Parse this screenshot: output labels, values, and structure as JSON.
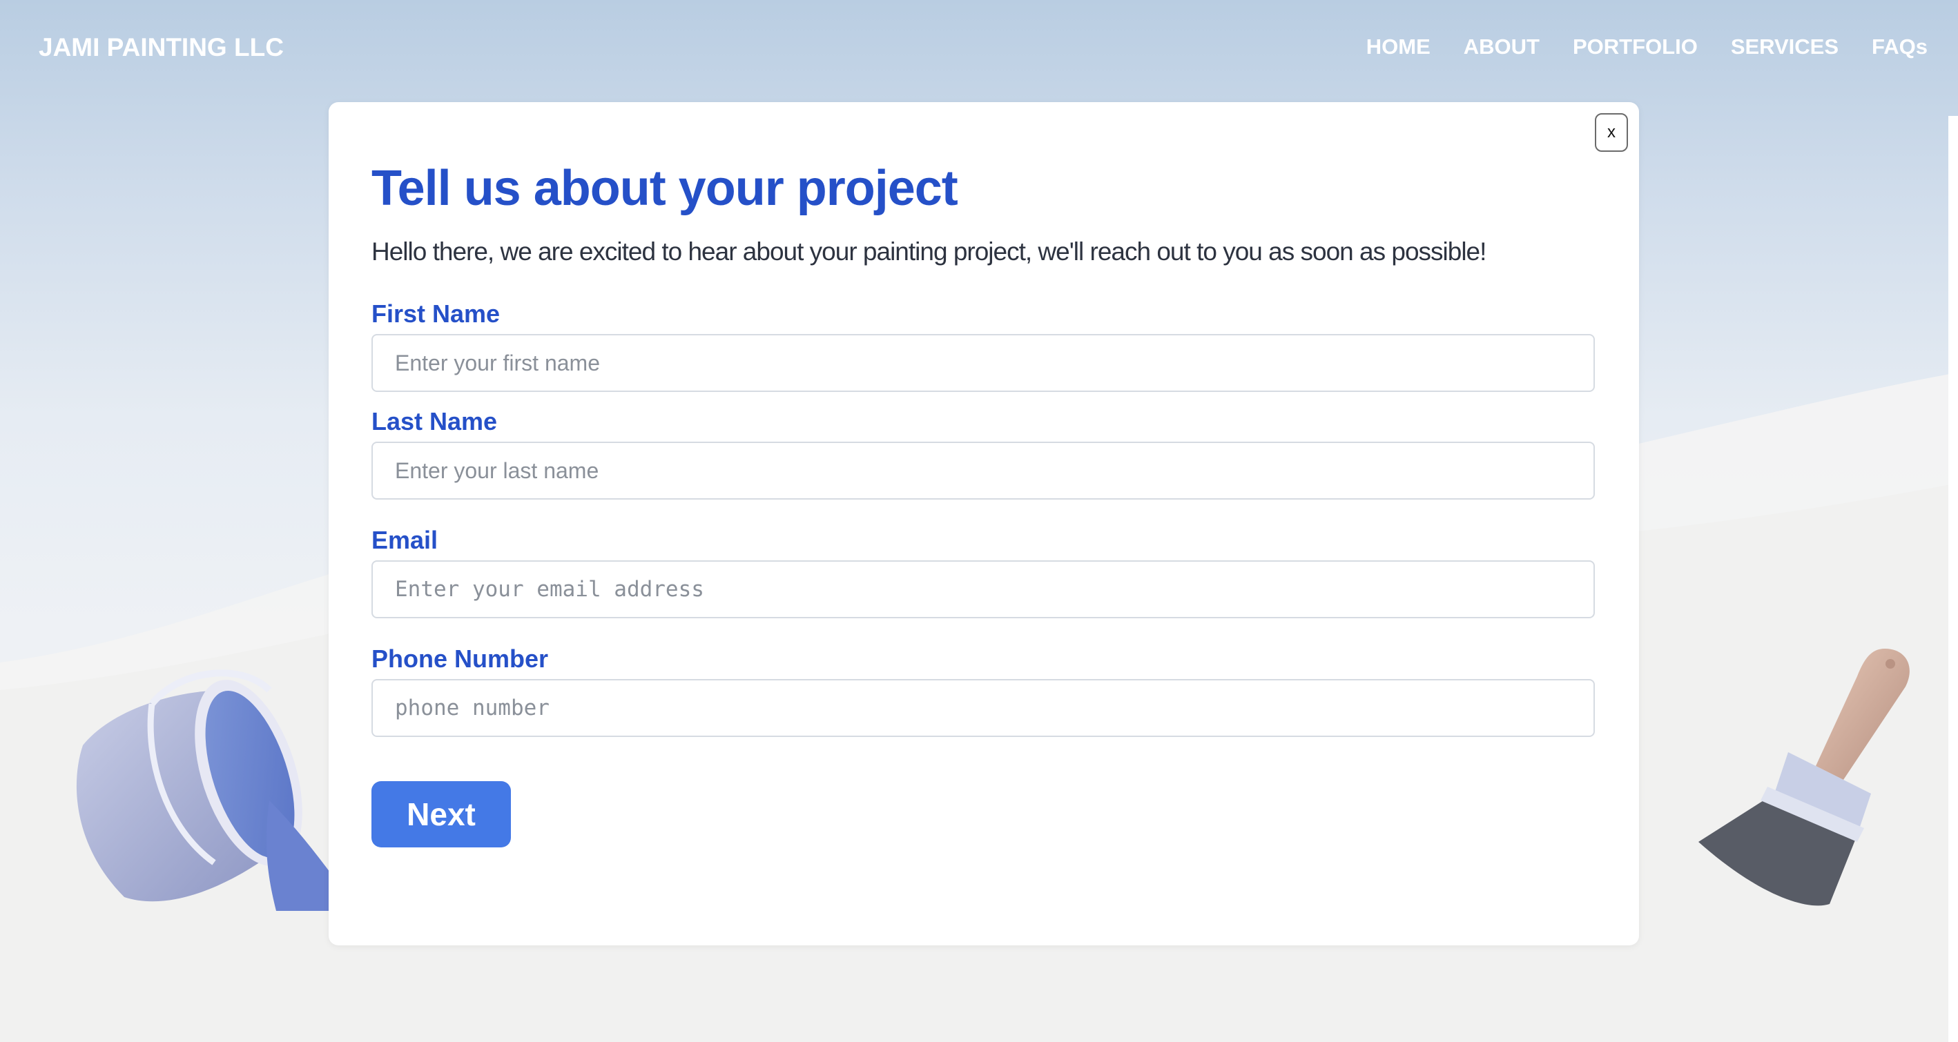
{
  "header": {
    "brand": "JAMI PAINTING LLC",
    "nav": [
      "HOME",
      "ABOUT",
      "PORTFOLIO",
      "SERVICES",
      "FAQs"
    ]
  },
  "modal": {
    "close_label": "x",
    "title": "Tell us about your project",
    "subtitle": "Hello there, we are excited to hear about your painting project, we'll reach out to you as soon as possible!",
    "fields": {
      "first_name": {
        "label": "First Name",
        "placeholder": "Enter your first name",
        "value": ""
      },
      "last_name": {
        "label": "Last Name",
        "placeholder": "Enter your last name",
        "value": ""
      },
      "email": {
        "label": "Email",
        "placeholder": "Enter your email address",
        "value": ""
      },
      "phone": {
        "label": "Phone Number",
        "placeholder": "phone number",
        "value": ""
      }
    },
    "next_label": "Next"
  },
  "colors": {
    "accent": "#2550c8",
    "button": "#4479e6",
    "sky_top": "#b9cde2",
    "background": "#f2f2f2"
  },
  "icons": {
    "decor_left": "paint-bucket-icon",
    "decor_right": "paint-brush-icon"
  }
}
